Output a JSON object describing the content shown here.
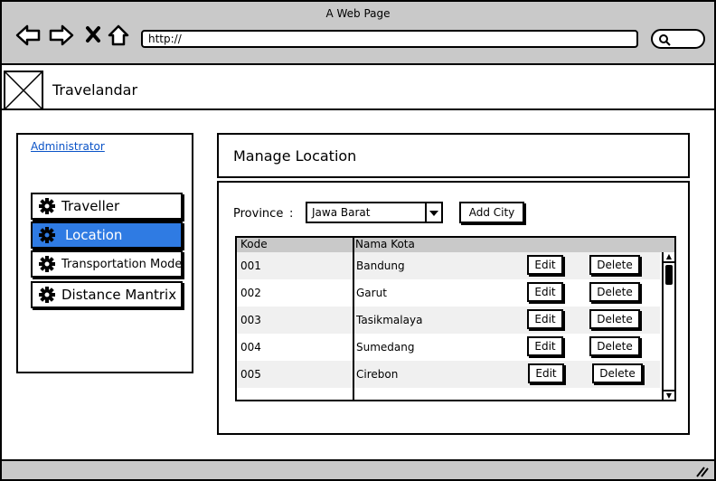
{
  "window": {
    "title": "A Web Page"
  },
  "browser": {
    "url": "http://"
  },
  "app": {
    "title": "Travelandar"
  },
  "sidebar": {
    "admin_link": "Administrator",
    "items": [
      {
        "label": "Traveller",
        "icon": "gear-icon",
        "active": false
      },
      {
        "label": "Location",
        "icon": "gear-icon",
        "active": true
      },
      {
        "label": "Transportation Mode",
        "icon": "gear-icon",
        "active": false
      },
      {
        "label": "Distance Mantrix",
        "icon": "gear-icon",
        "active": false
      }
    ]
  },
  "page": {
    "title": "Manage Location"
  },
  "filter": {
    "province_label": "Province",
    "colon": ":",
    "province_value": "Jawa Barat",
    "add_city_label": "Add City"
  },
  "table": {
    "headers": [
      "Kode",
      "Nama Kota"
    ],
    "edit_label": "Edit",
    "delete_label": "Delete",
    "rows": [
      {
        "kode": "001",
        "nama": "Bandung"
      },
      {
        "kode": "002",
        "nama": "Garut"
      },
      {
        "kode": "003",
        "nama": "Tasikmalaya"
      },
      {
        "kode": "004",
        "nama": "Sumedang"
      },
      {
        "kode": "005",
        "nama": "Cirebon"
      }
    ]
  },
  "colors": {
    "chrome": "#c9c9c9",
    "accent": "#2f7be3",
    "link": "#0a53c7"
  }
}
